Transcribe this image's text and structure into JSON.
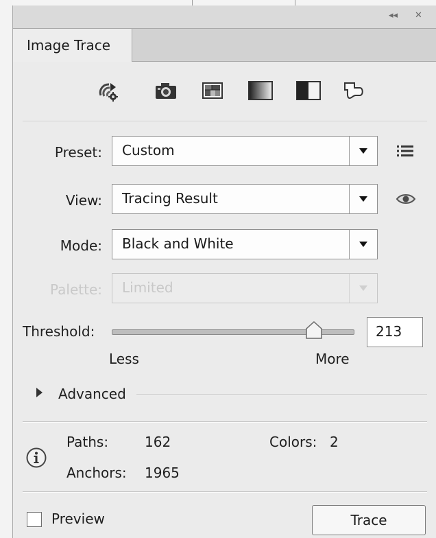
{
  "panel": {
    "title": "Image Trace",
    "collapse_glyph": "◂◂",
    "close_glyph": "✕"
  },
  "presets": {
    "buttons": [
      {
        "name": "auto-color-preset",
        "icon": "auto-color-icon"
      },
      {
        "name": "high-color-preset",
        "icon": "camera-icon"
      },
      {
        "name": "low-color-preset",
        "icon": "grid-image-icon"
      },
      {
        "name": "grayscale-preset",
        "icon": "grayscale-gradient-icon"
      },
      {
        "name": "black-and-white-preset",
        "icon": "black-white-icon"
      },
      {
        "name": "outline-preset",
        "icon": "outline-shape-icon"
      }
    ]
  },
  "settings": {
    "preset_label": "Preset:",
    "preset_value": "Custom",
    "view_label": "View:",
    "view_value": "Tracing Result",
    "mode_label": "Mode:",
    "mode_value": "Black and White",
    "palette_label": "Palette:",
    "palette_value": "Limited"
  },
  "threshold": {
    "label": "Threshold:",
    "value": "213",
    "level": 213,
    "min": 1,
    "max": 255,
    "less_label": "Less",
    "more_label": "More"
  },
  "advanced": {
    "label": "Advanced"
  },
  "stats": {
    "paths_label": "Paths:",
    "paths_value": "162",
    "colors_label": "Colors:",
    "colors_value": "2",
    "anchors_label": "Anchors:",
    "anchors_value": "1965"
  },
  "footer": {
    "preview_label": "Preview",
    "preview_checked": false,
    "trace_label": "Trace"
  }
}
